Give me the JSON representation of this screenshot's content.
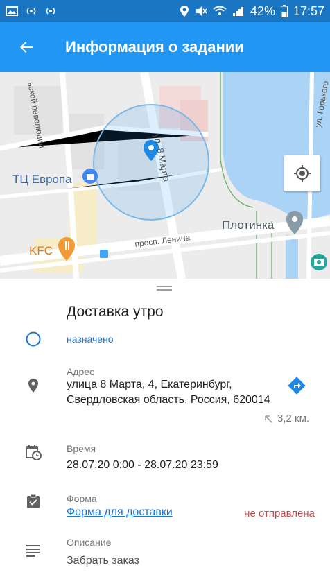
{
  "status_bar": {
    "battery_percent": "42%",
    "time": "17:57"
  },
  "app_bar": {
    "title": "Информация о задании",
    "back_icon": "arrow-back-icon"
  },
  "map": {
    "labels": {
      "street_top_left": "ьской революции",
      "street_vertical": "ул. 8 Марта",
      "street_top_right": "ул. Горького",
      "mall": "ТЦ Европа",
      "dam": "Плотинка",
      "kfc": "KFC",
      "avenue": "просп. Ленина"
    },
    "colors": {
      "water": "#aad3f5",
      "circle_fill": "rgba(33,150,243,0.15)",
      "pin": "#1e88e5"
    }
  },
  "task": {
    "title": "Доставка утро",
    "status": "назначено",
    "address_label": "Адрес",
    "address_line1": "улица 8 Марта, 4, Екатеринбург,",
    "address_line2": "Свердловская область, Россия, 620014",
    "distance": "3,2 км.",
    "time_label": "Время",
    "time_value": "28.07.20 0:00 - 28.07.20 23:59",
    "form_label": "Форма",
    "form_link": "Форма для доставки",
    "form_state": "не отправлена",
    "description_label": "Описание",
    "description_value": "Забрать заказ"
  }
}
